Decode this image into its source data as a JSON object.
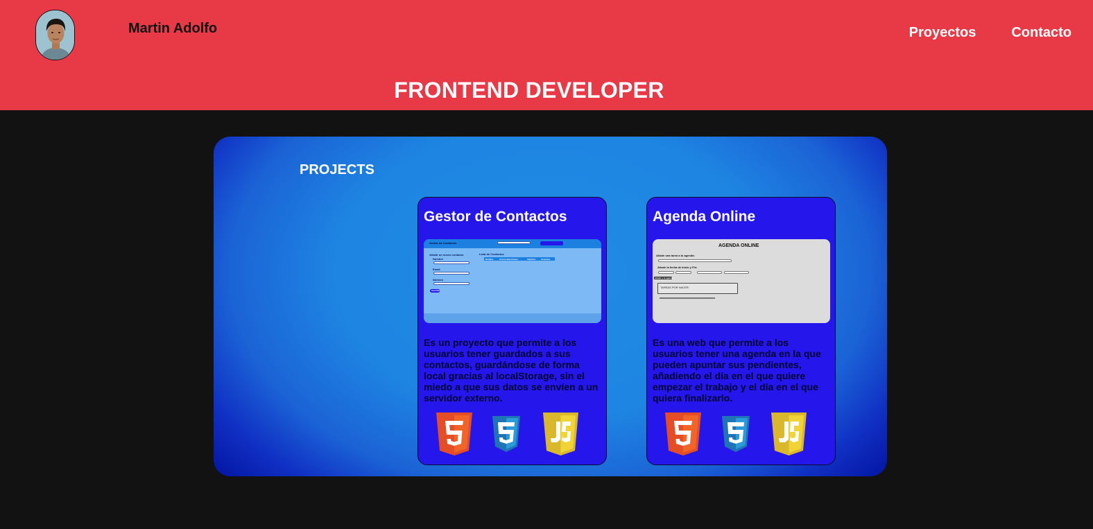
{
  "header": {
    "name": "Martin Adolfo",
    "nav": [
      "Proyectos",
      "Contacto"
    ],
    "headline": "FRONTEND DEVELOPER"
  },
  "projects": {
    "title": "PROJECTS",
    "cards": [
      {
        "title": "Gestor de Contactos",
        "description": "Es un proyecto que permite a los usuarios tener guardados a sus contactos, guardándose de forma local gracias al localStorage, sin el miedo a que sus datos se envíen a un servidor externo.",
        "preview": {
          "header": "Gestor de Contactos",
          "add_title": "Añadir un nuevo contacto",
          "list_title": "Lista de Contactos",
          "fields": [
            "Nombre",
            "Email",
            "Número"
          ],
          "button": "Guardar",
          "columns": [
            "Nombre",
            "Correo Electrónico",
            "Teléfono",
            "Acciones"
          ]
        },
        "tech": [
          "HTML5",
          "CSS3",
          "JS"
        ]
      },
      {
        "title": "Agenda Online",
        "description": "Es una web que permite a los usuarios tener una agenda en la que pueden apuntar sus pendientes, añadiendo el día en el que quiere empezar el trabajo y el día en el que quiera finalizarlo.",
        "preview": {
          "header": "AGENDA ONLINE",
          "label1": "Añade una tarea a tu agenda:",
          "label2": "Añade la fecha de Inicio y Fin:",
          "button": "Añadir a la agenda",
          "box_title": "TAREAS POR HACER:"
        },
        "tech": [
          "HTML5",
          "CSS3",
          "JS"
        ]
      }
    ]
  },
  "colors": {
    "header_bg": "#e83947",
    "page_bg": "#121212",
    "card_bg": "#2516ec",
    "html5": "#e44d26",
    "css3": "#1f73b7",
    "js": "#d9b82d"
  }
}
